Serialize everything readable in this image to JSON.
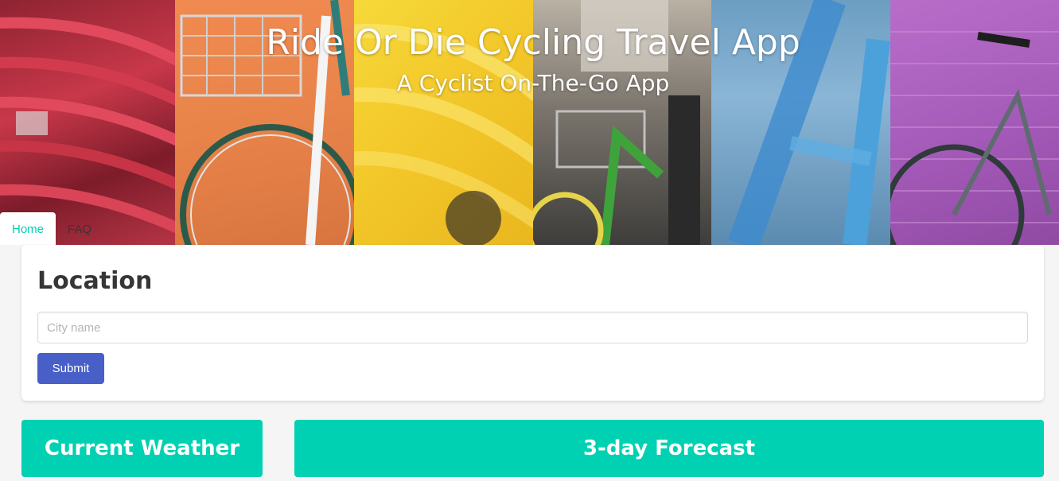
{
  "header": {
    "title": "Ride Or Die Cycling Travel App",
    "subtitle": "A Cyclist On-The-Go App"
  },
  "nav": {
    "tabs": [
      {
        "label": "Home",
        "active": true
      },
      {
        "label": "FAQ",
        "active": false
      }
    ]
  },
  "location": {
    "title": "Location",
    "input_placeholder": "City name",
    "input_value": "",
    "submit_label": "Submit"
  },
  "cards": {
    "current_weather": "Current Weather",
    "forecast": "3-day Forecast"
  },
  "colors": {
    "accent": "#00d1b2",
    "button": "#485fc7",
    "text": "#363636"
  }
}
